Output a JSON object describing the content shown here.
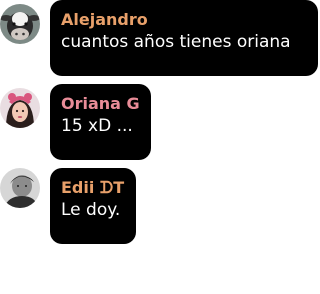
{
  "messages": [
    {
      "sender": "Alejandro",
      "text": "cuantos años tienes oriana",
      "avatar_icon": "cow-avatar",
      "name_color": "#e8a06a"
    },
    {
      "sender": "Oriana G",
      "text": "15 xD ...",
      "avatar_icon": "girl-avatar",
      "name_color": "#e98c98"
    },
    {
      "sender": "Edii ᗪT",
      "text": "Le doy.",
      "avatar_icon": "boy-avatar",
      "name_color": "#e8a06a"
    }
  ],
  "colors": {
    "bubble": "#000000",
    "message_text": "#ffffff",
    "background": "#ffffff"
  }
}
